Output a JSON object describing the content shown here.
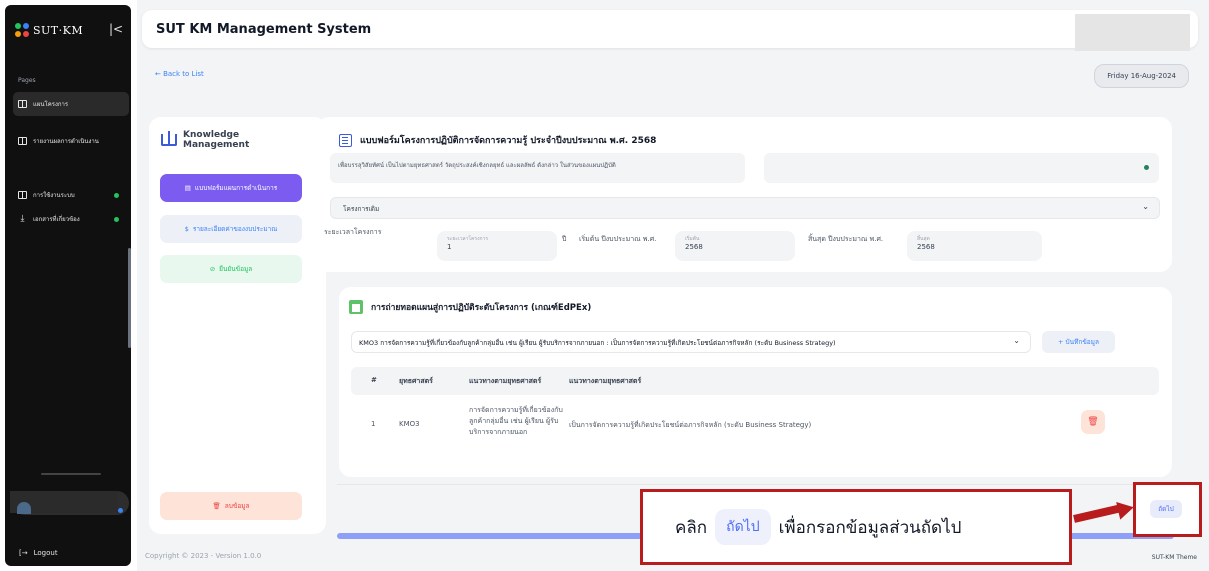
{
  "sidebar": {
    "logo": "SUT·KM",
    "section_label": "Pages",
    "items": [
      {
        "label": "แผนโครงการ"
      },
      {
        "label": "รายงานผลการดำเนินงาน"
      },
      {
        "label": "การใช้งานระบบ"
      },
      {
        "label": "เอกสารที่เกี่ยวข้อง"
      }
    ],
    "logout": "Logout"
  },
  "header": {
    "title": "SUT KM Management System",
    "back_label": "← Back to List",
    "date": "Friday 16-Aug-2024"
  },
  "left_panel": {
    "logo_line1": "Knowledge",
    "logo_line2": "Management",
    "btn_form": "แบบฟอร์มแผนการดำเนินการ",
    "btn_budget": "รายละเอียดค่าของงบประมาณ",
    "btn_confirm": "ยืนยันข้อมูล",
    "btn_delete": "ลบข้อมูล"
  },
  "form": {
    "title": "แบบฟอร์มโครงการปฏิบัติการจัดการความรู้ ประจำปีงบประมาณ พ.ศ. 2568",
    "objective_text": "เพื่อบรรลุวิสัยทัศน์ เป็นไปตามยุทธศาสตร์ วัตถุประสงค์เชิงกลยุทธ์ และผลลัพธ์ ดังกล่าว ในส่วนของแผนปฏิบัติ",
    "project_type": "โครงการเดิม",
    "period_label": "ระยะเวลาโครงการ",
    "period_placeholder": "ระยะเวลาโครงการ",
    "period_value": "1",
    "year_unit": "ปี",
    "start_label": "เริ่มต้น ปีงบประมาณ พ.ศ.",
    "start_field_label": "เริ่มต้น",
    "start_value": "2568",
    "end_label": "สิ้นสุด ปีงบประมาณ พ.ศ.",
    "end_field_label": "สิ้นสุด",
    "end_value": "2568"
  },
  "plan": {
    "title": "การถ่ายทอดแผนสู่การปฏิบัติระดับโครงการ (เกณฑ์EdPEx)",
    "select_value": "KMO3 การจัดการความรู้ที่เกี่ยวข้องกับลูกค้ากลุ่มอื่น เช่น ผู้เรียน ผู้รับบริการจากภายนอก : เป็นการจัดการความรู้ที่เกิดประโยชน์ต่อภารกิจหลัก (ระดับ Business Strategy)",
    "add_label": "+ บันทึกข้อมูล",
    "columns": [
      "#",
      "ยุทธศาสตร์",
      "แนวทางตามยุทธศาสตร์",
      "แนวทางตามยุทธศาสตร์"
    ],
    "rows": [
      {
        "no": "1",
        "code": "KMO3",
        "desc": "การจัดการความรู้ที่เกี่ยวข้องกับลูกค้ากลุ่มอื่น เช่น ผู้เรียน ผู้รับบริการจากภายนอก",
        "approach": "เป็นการจัดการความรู้ที่เกิดประโยชน์ต่อภารกิจหลัก (ระดับ Business Strategy)"
      }
    ]
  },
  "footer": {
    "copyright": "Copyright © 2023 - Version 1.0.0",
    "theme": "SUT-KM Theme"
  },
  "callout": {
    "prefix": "คลิก",
    "chip": "ถัดไป",
    "suffix": "เพื่อกรอกข้อมูลส่วนถัดไป"
  },
  "next_button": "ถัดไป",
  "colors": {
    "accent": "#7c5cf0",
    "link": "#3b82f6",
    "danger": "#ef4444",
    "callout_border": "#b91c1c"
  }
}
